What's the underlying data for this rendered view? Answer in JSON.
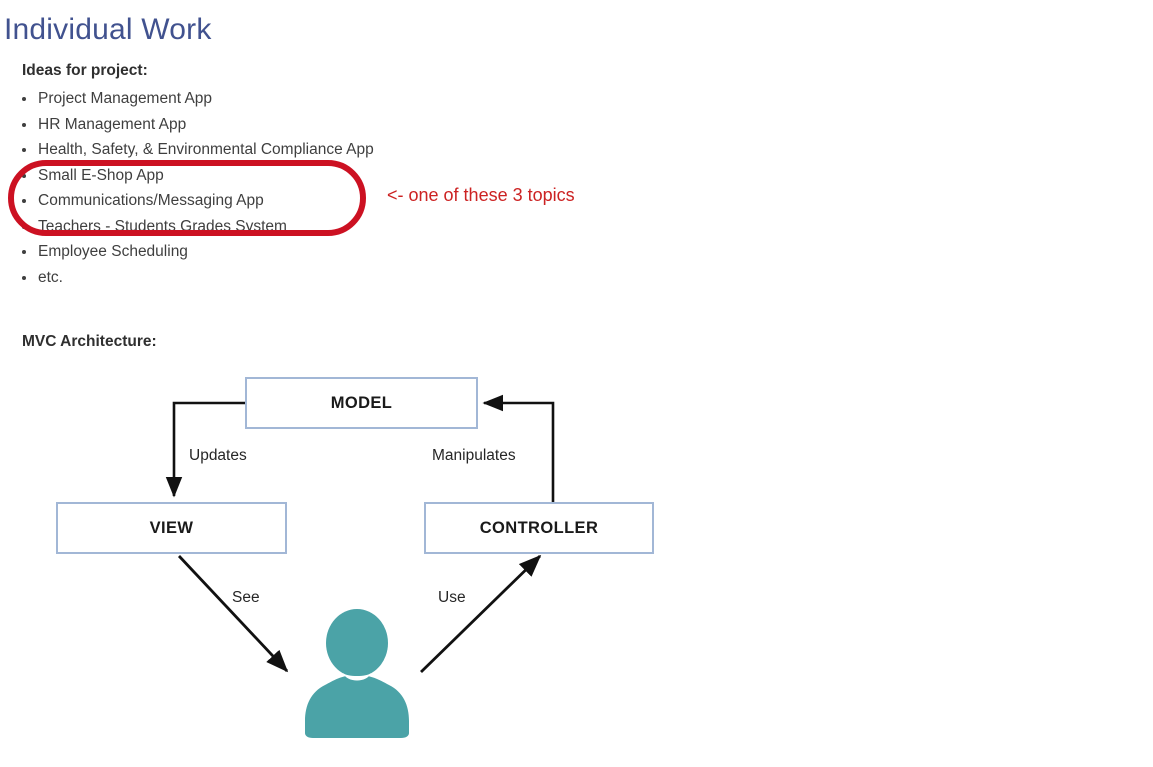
{
  "page": {
    "title": "Individual Work"
  },
  "ideas": {
    "heading": "Ideas for project:",
    "items": [
      "Project Management App",
      "HR Management App",
      "Health, Safety, & Environmental Compliance App",
      "Small E-Shop App",
      "Communications/Messaging App",
      "Teachers - Students Grades System",
      "Employee Scheduling",
      "etc."
    ],
    "annotation": {
      "text": "<- one of these 3 topics",
      "color": "#cc2222"
    },
    "highlight": {
      "shape": "rounded-rectangle",
      "color": "#cc1122",
      "covers": [
        "Small E-Shop App",
        "Communications/Messaging App",
        "Teachers - Students Grades System"
      ]
    }
  },
  "mvc": {
    "heading": "MVC Architecture:",
    "boxes": {
      "model": "MODEL",
      "view": "VIEW",
      "controller": "CONTROLLER"
    },
    "edge_labels": {
      "updates": "Updates",
      "manipulates": "Manipulates",
      "see": "See",
      "use": "Use"
    },
    "actor": "user-person-icon",
    "colors": {
      "box_border": "#a2b7d6",
      "arrow": "#111111",
      "actor": "#4ba3a7"
    }
  }
}
